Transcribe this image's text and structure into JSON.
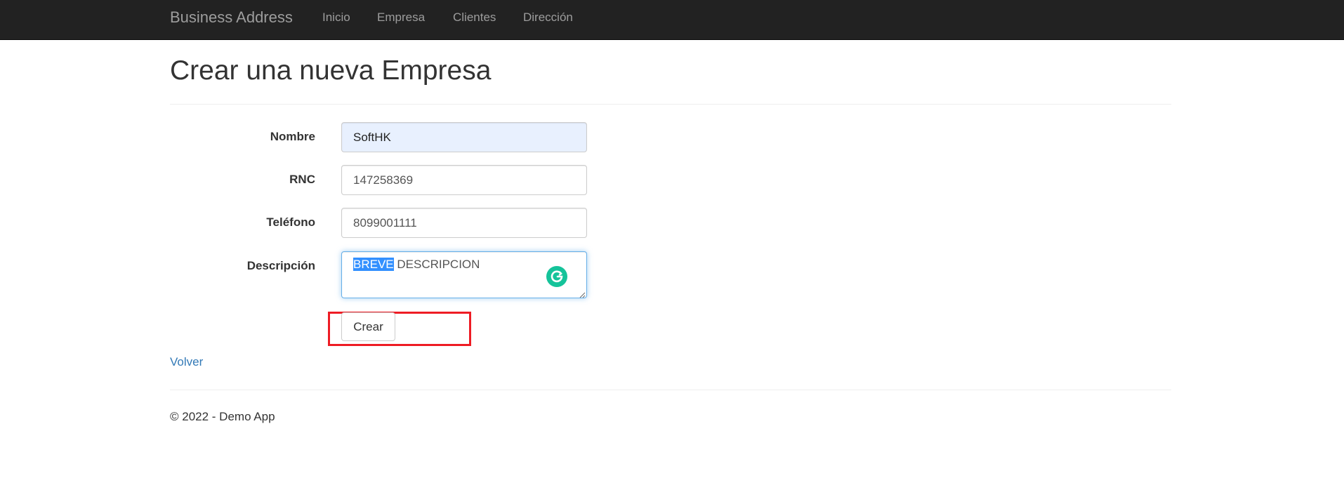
{
  "navbar": {
    "brand": "Business Address",
    "links": [
      "Inicio",
      "Empresa",
      "Clientes",
      "Dirección"
    ]
  },
  "page": {
    "title": "Crear una nueva Empresa"
  },
  "form": {
    "nombre_label": "Nombre",
    "nombre_value": "SoftHK",
    "rnc_label": "RNC",
    "rnc_value": "147258369",
    "telefono_label": "Teléfono",
    "telefono_value": "8099001111",
    "descripcion_label": "Descripción",
    "descripcion_selected": "BREVE",
    "descripcion_rest": " DESCRIPCION",
    "submit_label": "Crear"
  },
  "back_link": "Volver",
  "footer": {
    "text": "© 2022 - Demo App"
  },
  "colors": {
    "navbar_bg": "#222222",
    "link": "#337ab7",
    "highlight_box": "#ee1c24",
    "grammarly": "#15c39a"
  }
}
